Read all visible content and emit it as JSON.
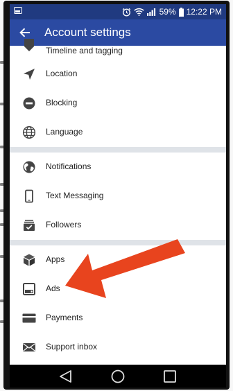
{
  "status_bar": {
    "battery": "59%",
    "time": "12:22 PM",
    "icons": [
      "photo-notification-icon",
      "alarm-icon",
      "wifi-icon",
      "signal-icon",
      "battery-icon"
    ]
  },
  "app_bar": {
    "title": "Account settings",
    "back_icon": "back-arrow-icon",
    "background": "#2b4aa2",
    "status_background": "#203a80"
  },
  "groups": [
    {
      "items": [
        {
          "label": "Timeline and tagging",
          "icon": "timeline-icon"
        },
        {
          "label": "Location",
          "icon": "location-arrow-icon"
        },
        {
          "label": "Blocking",
          "icon": "block-icon"
        },
        {
          "label": "Language",
          "icon": "globe-icon"
        }
      ]
    },
    {
      "items": [
        {
          "label": "Notifications",
          "icon": "globe-filled-icon"
        },
        {
          "label": "Text Messaging",
          "icon": "phone-icon"
        },
        {
          "label": "Followers",
          "icon": "followers-icon"
        }
      ]
    },
    {
      "items": [
        {
          "label": "Apps",
          "icon": "cube-icon"
        },
        {
          "label": "Ads",
          "icon": "ads-icon"
        },
        {
          "label": "Payments",
          "icon": "card-icon"
        },
        {
          "label": "Support inbox",
          "icon": "mail-icon"
        }
      ]
    }
  ],
  "annotation": {
    "color": "#e8441e",
    "points_to": "Ads"
  },
  "nav_bar": {
    "buttons": [
      "back-triangle-icon",
      "home-circle-icon",
      "recents-square-icon"
    ]
  }
}
